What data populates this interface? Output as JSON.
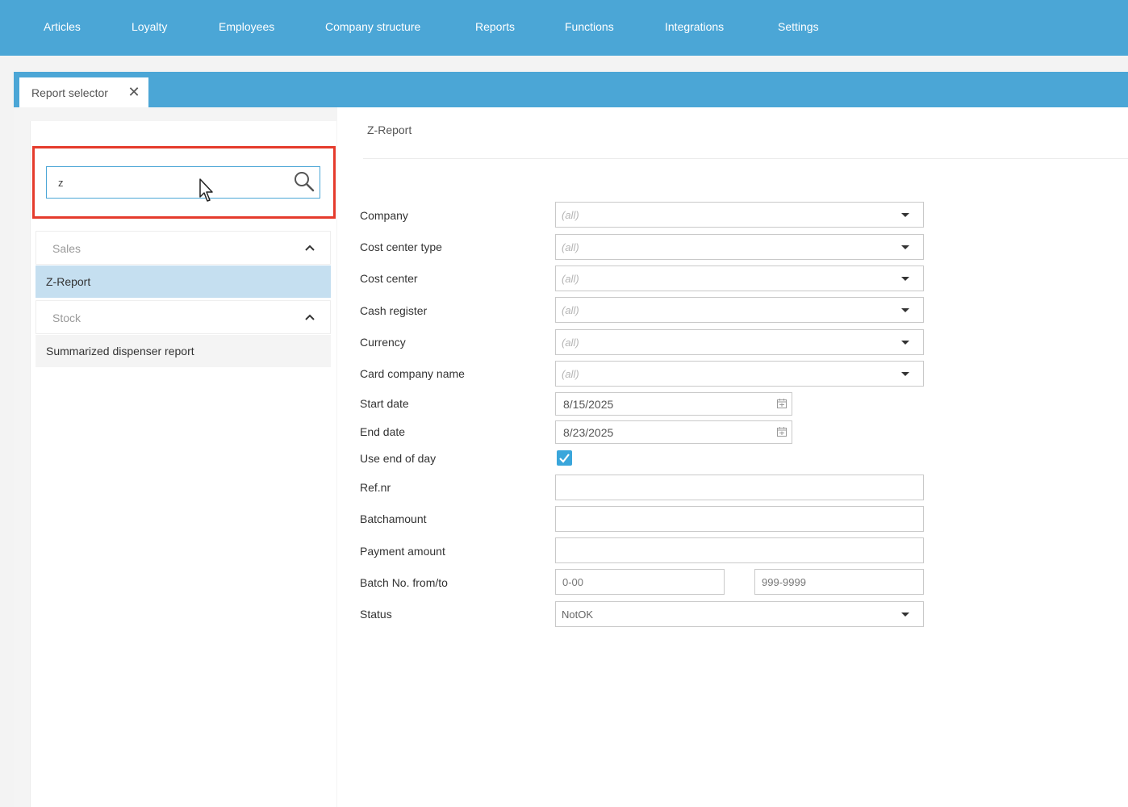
{
  "nav": {
    "items": [
      "Articles",
      "Loyalty",
      "Employees",
      "Company structure",
      "Reports",
      "Functions",
      "Integrations",
      "Settings"
    ]
  },
  "tab": {
    "label": "Report selector",
    "close_icon": "close-icon"
  },
  "search": {
    "value": "z",
    "icon": "search-icon"
  },
  "tree": {
    "groups": [
      {
        "label": "Sales",
        "items": [
          "Z-Report"
        ]
      },
      {
        "label": "Stock",
        "items": [
          "Summarized dispenser report"
        ]
      }
    ]
  },
  "form": {
    "title": "Z-Report",
    "company": {
      "label": "Company",
      "value": "(all)"
    },
    "cost_center_type": {
      "label": "Cost center type",
      "value": "(all)"
    },
    "cost_center": {
      "label": "Cost center",
      "value": "(all)"
    },
    "cash_register": {
      "label": "Cash register",
      "value": "(all)"
    },
    "currency": {
      "label": "Currency",
      "value": "(all)"
    },
    "card_company": {
      "label": "Card company name",
      "value": "(all)"
    },
    "start_date": {
      "label": "Start date",
      "value": "8/15/2025"
    },
    "end_date": {
      "label": "End date",
      "value": "8/23/2025"
    },
    "use_end_of_day": {
      "label": "Use end of day",
      "checked": true
    },
    "ref_nr": {
      "label": "Ref.nr",
      "value": ""
    },
    "batchamount": {
      "label": "Batchamount",
      "value": ""
    },
    "payment_amount": {
      "label": "Payment amount",
      "value": ""
    },
    "batch_no": {
      "label": "Batch No. from/to",
      "from": "0-00",
      "to": "999-9999"
    },
    "status": {
      "label": "Status",
      "value": "NotOK"
    }
  },
  "colors": {
    "accent": "#4ba6d6",
    "selected_row": "#c5dff0",
    "highlight_border": "#e53b2c",
    "checkbox": "#3aa6db"
  }
}
